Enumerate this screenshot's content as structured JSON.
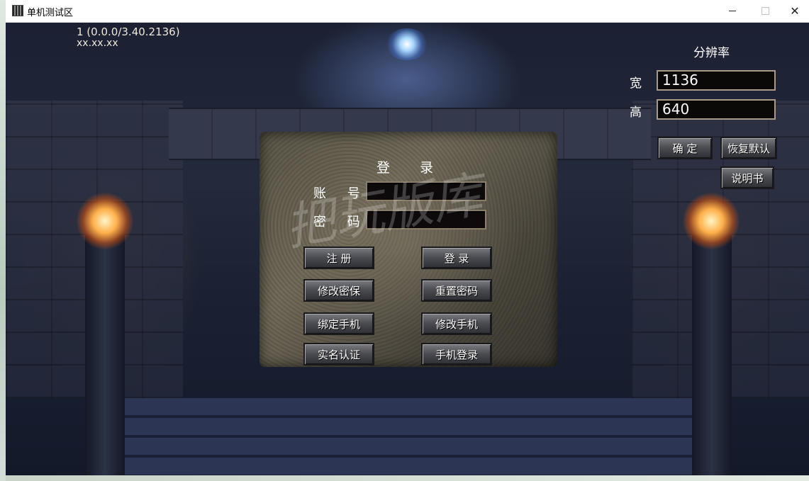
{
  "window": {
    "title": "单机测试区",
    "controls": [
      "minimize",
      "maximize",
      "close"
    ]
  },
  "game": {
    "version_line": "1 (0.0.0/3.40.2136)",
    "ip_line": "xx.xx.xx"
  },
  "resolution": {
    "title": "分辨率",
    "width_label": "宽",
    "width_value": "1136",
    "height_label": "高",
    "height_value": "640",
    "confirm_label": "确 定",
    "reset_label": "恢复默认",
    "manual_label": "说明书"
  },
  "login": {
    "title": "登 录",
    "account_label": "账 号",
    "password_label": "密 码",
    "account_value": "",
    "password_value": "",
    "buttons": {
      "register": "注 册",
      "login": "登 录",
      "change_security": "修改密保",
      "reset_password": "重置密码",
      "bind_phone": "绑定手机",
      "change_phone": "修改手机",
      "real_name": "实名认证",
      "phone_login": "手机登录"
    }
  },
  "watermark": "把玩版库",
  "colors": {
    "button_text": "#ffffff",
    "input_bg": "#0b0808",
    "titlebar_bg": "#ffffff"
  }
}
